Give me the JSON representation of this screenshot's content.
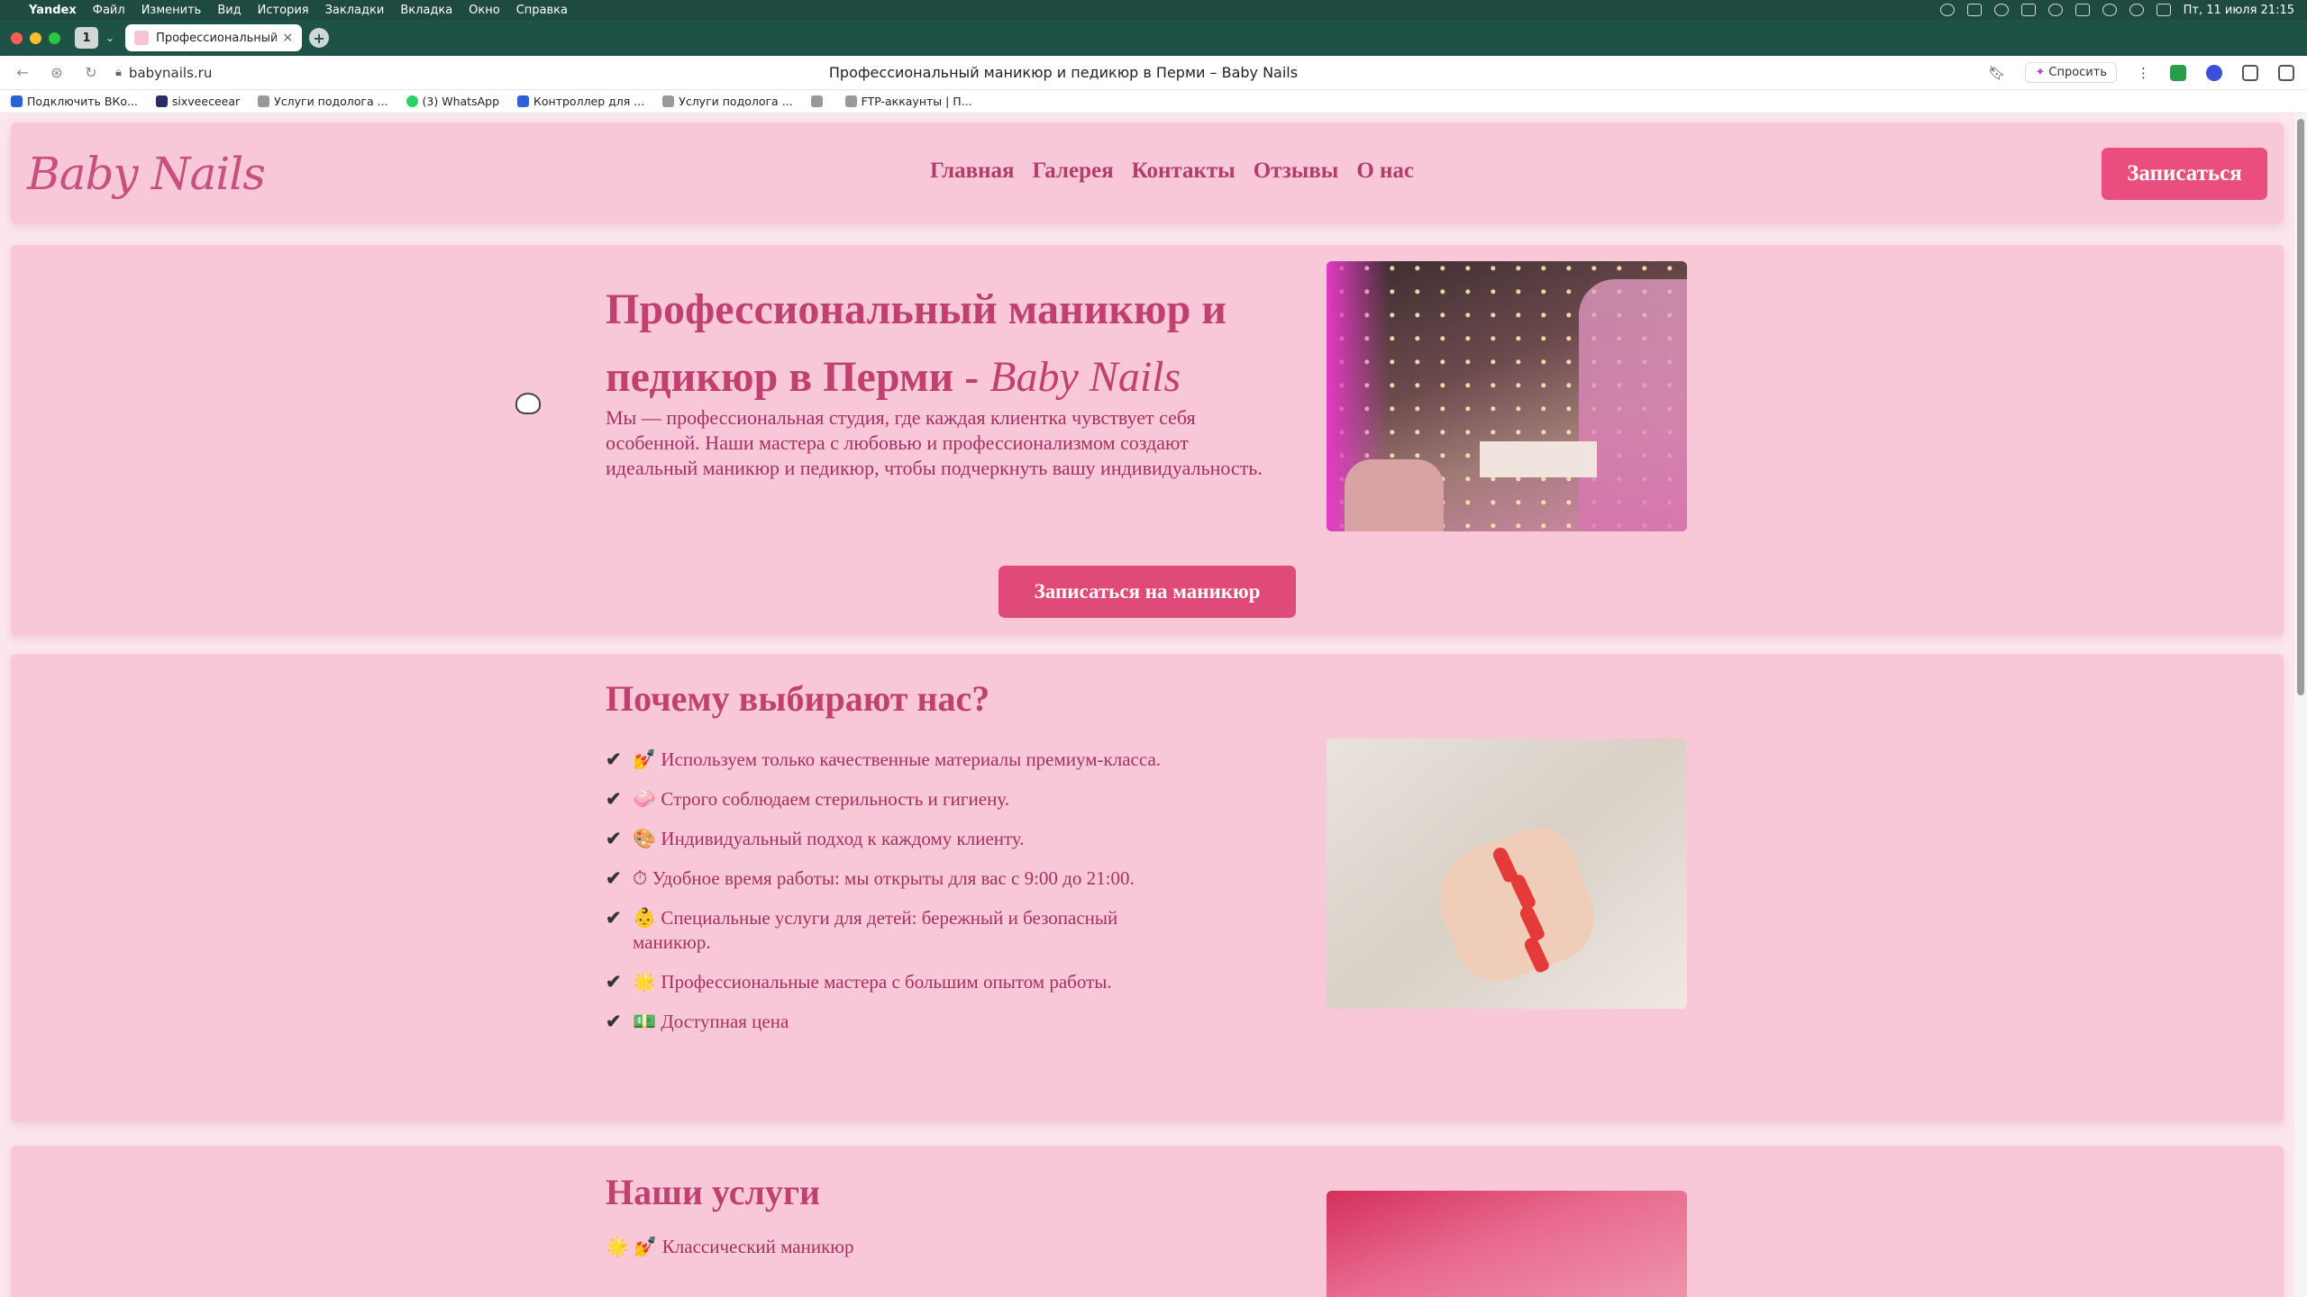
{
  "menubar": {
    "app": "Yandex",
    "items": [
      "Файл",
      "Изменить",
      "Вид",
      "История",
      "Закладки",
      "Вкладка",
      "Окно",
      "Справка"
    ],
    "datetime": "Пт, 11 июля  21:15"
  },
  "tabbar": {
    "tab_count": "1",
    "tab_title": "Профессиональный м",
    "new_tab": "+"
  },
  "address": {
    "url": "babynails.ru",
    "page_title": "Профессиональный маникюр и педикюр в Перми – Baby Nails",
    "ask_label": "Спросить"
  },
  "bookmarks": [
    "Подключить ВКо...",
    "sixveeceear",
    "Услуги подолога ...",
    "(3) WhatsApp",
    "Контроллер для ...",
    "Услуги подолога ...",
    "",
    "FTP-аккаунты | П..."
  ],
  "site": {
    "logo": "Baby Nails",
    "nav": [
      "Главная",
      "Галерея",
      "Контакты",
      "Отзывы",
      "О нас"
    ],
    "header_cta": "Записаться",
    "hero": {
      "title_main": "Профессиональный маникюр и педикюр в Перми - ",
      "title_brand": "Baby Nails",
      "lead": "Мы — профессиональная студия, где каждая клиентка чувствует себя особенной. Наши мастера с любовью и профессионализмом создают идеальный маникюр и педикюр, чтобы подчеркнуть вашу индивидуальность.",
      "button": "Записаться на маникюр"
    },
    "why": {
      "title": "Почему выбирают нас?",
      "check": "✔",
      "items": [
        "💅 Используем только качественные материалы премиум-класса.",
        "🧼 Строго соблюдаем стерильность и гигиену.",
        "🎨 Индивидуальный подход к каждому клиенту.",
        "⏱ Удобное время работы: мы открыты для вас с 9:00 до 21:00.",
        "👶 Специальные услуги для детей: бережный и безопасный маникюр.",
        "🌟 Профессиональные мастера с большим опытом работы.",
        "💵 Доступная цена"
      ]
    },
    "services": {
      "title": "Наши услуги",
      "items": [
        "🌟 💅 Классический маникюр"
      ]
    }
  },
  "colors": {
    "brand_pink": "#e94e7e",
    "heading_pink": "#c0406e",
    "section_bg": "#f9c8d8"
  }
}
